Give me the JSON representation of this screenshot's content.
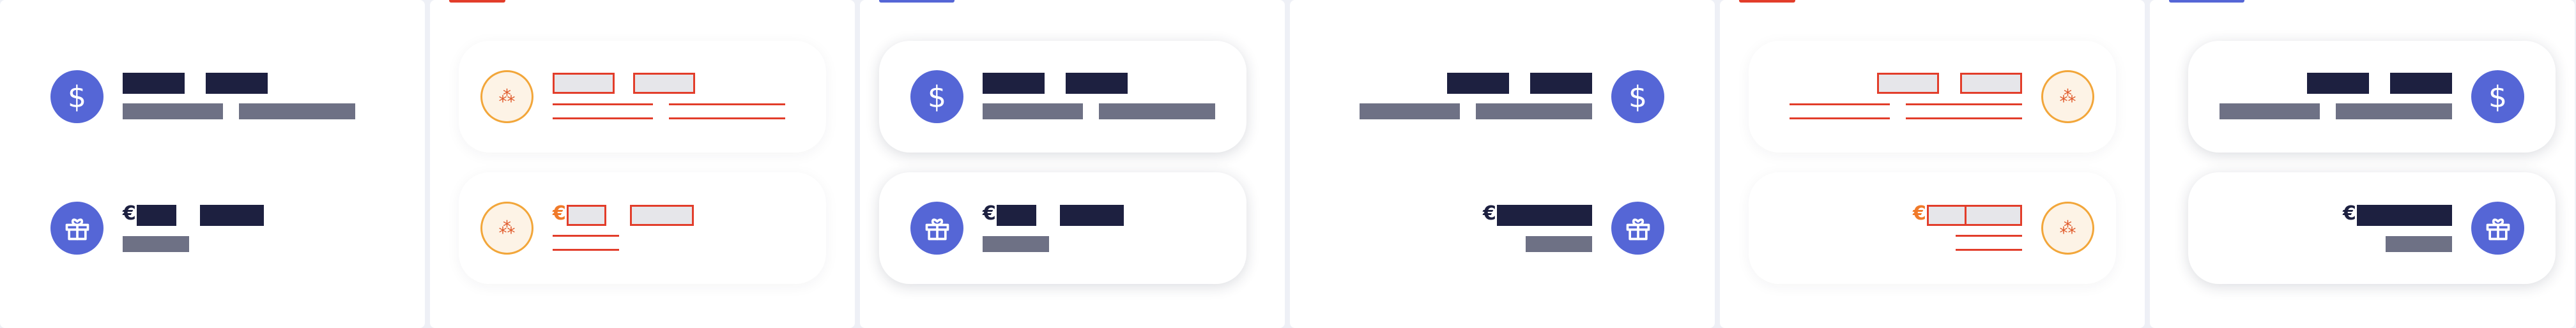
{
  "colors": {
    "background": "#eef0f6",
    "panel": "#ffffff",
    "accent_blue": "#5566d6",
    "text_dark": "#1d2040",
    "text_muted": "#6e7185",
    "debug_red": "#e23d2a",
    "debug_orange": "#f2a63a"
  },
  "icons": {
    "dollar": {
      "name": "dollar-icon",
      "glyph": "$"
    },
    "gift": {
      "name": "gift-icon"
    },
    "euro": {
      "name": "euro-sign",
      "glyph": "€"
    }
  },
  "rows": {
    "balance": {
      "value": "",
      "secondary_value": "",
      "caption": "",
      "secondary_caption": ""
    },
    "bonus": {
      "currency_symbol": "€",
      "value": "",
      "secondary_value": "",
      "caption": ""
    }
  },
  "variants": [
    {
      "name": "ltr-plain"
    },
    {
      "name": "ltr-debug"
    },
    {
      "name": "ltr-card"
    },
    {
      "name": "rtl-plain"
    },
    {
      "name": "rtl-debug"
    },
    {
      "name": "rtl-card"
    }
  ]
}
